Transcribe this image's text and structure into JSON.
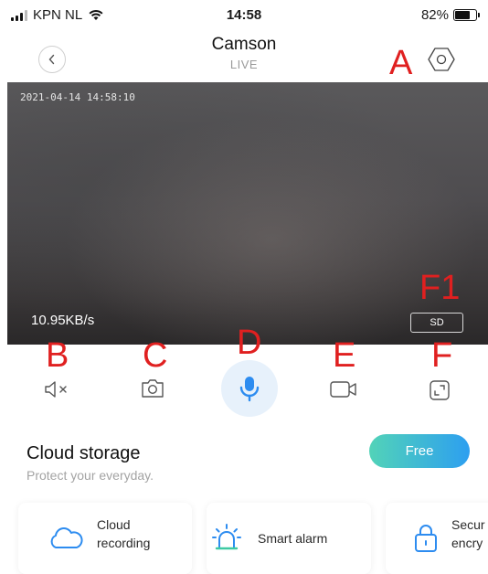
{
  "status_bar": {
    "carrier": "KPN NL",
    "time": "14:58",
    "battery": "82%",
    "battery_level": 0.82
  },
  "header": {
    "title": "Camson",
    "subtitle": "LIVE",
    "back_icon": "chevron-left-icon",
    "settings_icon": "hexagon-settings-icon"
  },
  "annotations": {
    "a": "A",
    "b": "B",
    "c": "C",
    "d": "D",
    "e": "E",
    "f": "F",
    "f1": "F1"
  },
  "video": {
    "timestamp": "2021-04-14 14:58:10",
    "bitrate": "10.95KB/s",
    "quality_label": "SD"
  },
  "controls": [
    {
      "name": "mute",
      "icon": "speaker-muted-icon"
    },
    {
      "name": "snapshot",
      "icon": "camera-icon"
    },
    {
      "name": "talk",
      "icon": "microphone-icon"
    },
    {
      "name": "record",
      "icon": "video-camera-icon"
    },
    {
      "name": "fullscreen",
      "icon": "fullscreen-icon"
    }
  ],
  "cloud_storage": {
    "title": "Cloud storage",
    "subtitle": "Protect your everyday.",
    "button_label": "Free"
  },
  "features": [
    {
      "line1": "Cloud",
      "line2": "recording",
      "icon": "cloud-icon"
    },
    {
      "line1": "Smart alarm",
      "icon": "alarm-light-icon"
    },
    {
      "line1": "Secur",
      "line2": "encry",
      "icon": "lock-icon"
    }
  ],
  "colors": {
    "accent": "#2d9ff0",
    "annotation_red": "#e02020",
    "free_gradient_start": "#52d3b8",
    "free_gradient_end": "#2d9ff0"
  }
}
